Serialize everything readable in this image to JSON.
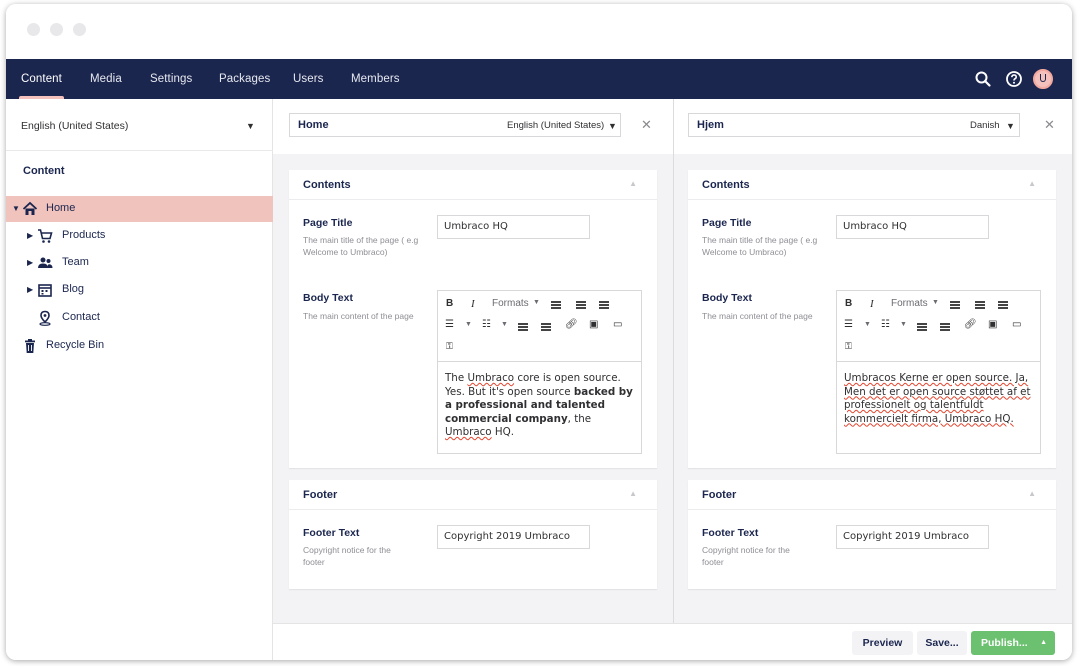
{
  "nav": {
    "items": [
      "Content",
      "Media",
      "Settings",
      "Packages",
      "Users",
      "Members"
    ],
    "active": "Content"
  },
  "tree": {
    "language": "English (United States)",
    "title": "Content",
    "items": [
      {
        "label": "Home",
        "icon": "home-icon"
      },
      {
        "label": "Products",
        "icon": "cart-icon"
      },
      {
        "label": "Team",
        "icon": "team-icon"
      },
      {
        "label": "Blog",
        "icon": "calendar-icon"
      },
      {
        "label": "Contact",
        "icon": "map-pin-icon"
      },
      {
        "label": "Recycle Bin",
        "icon": "trash-icon"
      }
    ]
  },
  "left_pane": {
    "name": "Home",
    "language": "English (United States)",
    "contents_title": "Contents",
    "page_title_label": "Page Title",
    "page_title_desc": "The main title of the page ( e.g Welcome to Umbraco)",
    "page_title_value": "Umbraco HQ",
    "body_text_label": "Body Text",
    "body_text_desc": "The main content of the page",
    "body_p1": "The ",
    "body_p2": "Umbraco",
    "body_p3": " core is open source. Yes. But it's open source ",
    "body_bold": "backed by a professional and talented commercial company",
    "body_p4": ", the ",
    "body_p5": "Umbraco",
    "body_p6": " HQ.",
    "footer_title": "Footer",
    "footer_text_label": "Footer Text",
    "footer_text_desc": "Copyright notice for the footer",
    "footer_text_value": "Copyright 2019 Umbraco"
  },
  "right_pane": {
    "name": "Hjem",
    "language": "Danish",
    "contents_title": "Contents",
    "page_title_label": "Page Title",
    "page_title_desc": "The main title of the page ( e.g Welcome to Umbraco)",
    "page_title_value": "Umbraco HQ",
    "body_text_label": "Body Text",
    "body_text_desc": "The main content of the page",
    "body_text_value": "Umbracos Kerne er open source. Ja, Men det er open source støttet af et professionelt og talentfuldt kommercielt firma, Umbraco HQ.",
    "footer_title": "Footer",
    "footer_text_label": "Footer Text",
    "footer_text_desc": "Copyright notice for the footer",
    "footer_text_value": "Copyright 2019 Umbraco"
  },
  "toolbar": {
    "bold": "B",
    "italic": "I",
    "formats": "Formats"
  },
  "actions": {
    "preview": "Preview",
    "save": "Save...",
    "publish": "Publish..."
  },
  "colors": {
    "nav_bg": "#1b264f",
    "accent": "#f5c1bc",
    "publish": "#6bc16f"
  }
}
